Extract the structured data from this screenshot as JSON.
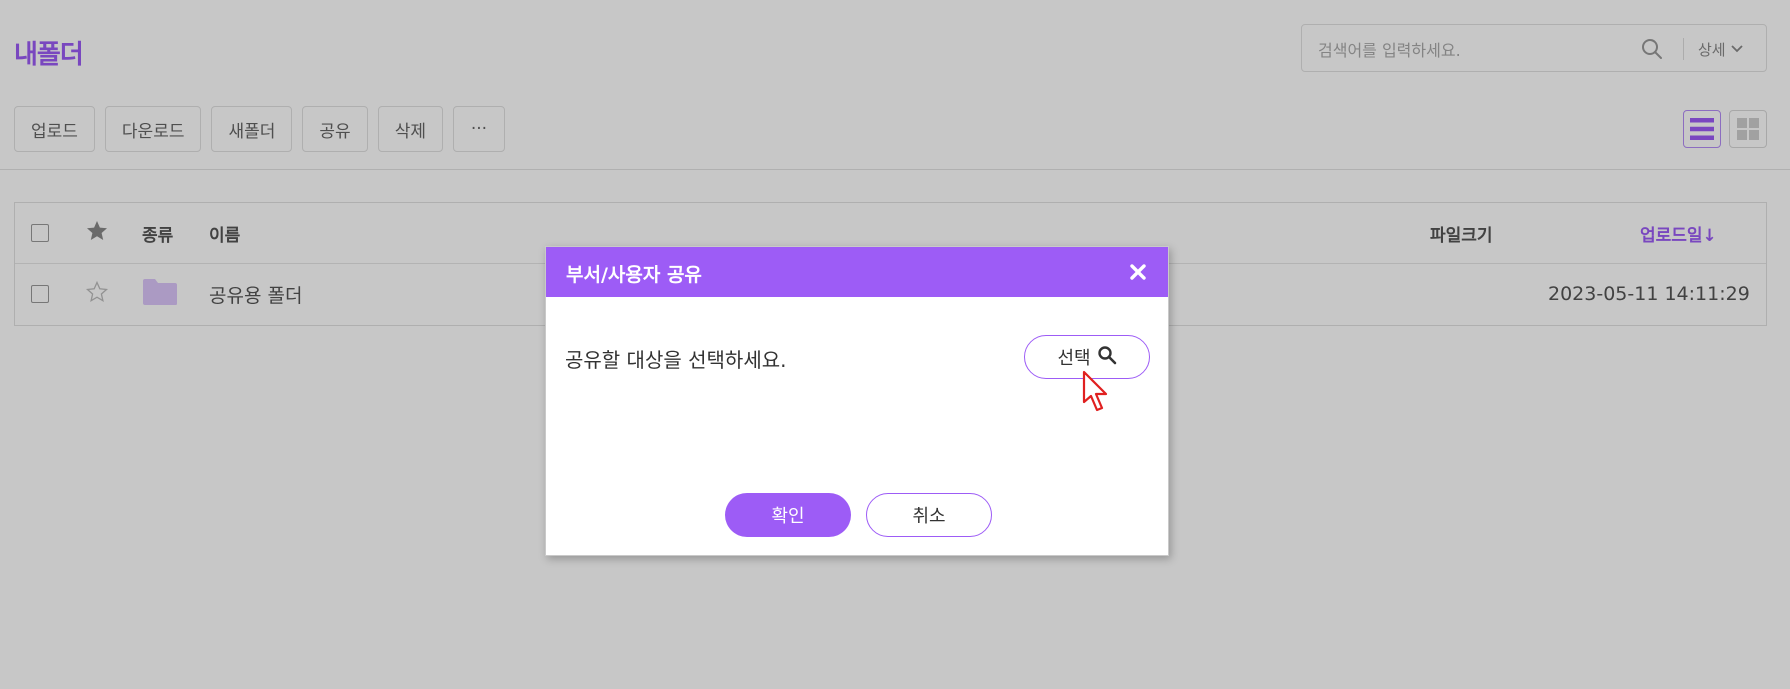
{
  "header": {
    "title": "내폴더",
    "search": {
      "placeholder": "검색어를 입력하세요.",
      "value": "",
      "detail_label": "상세",
      "search_icon": "search-icon",
      "detail_icon": "chevron-down-icon"
    }
  },
  "toolbar": {
    "buttons": [
      {
        "label": "업로드"
      },
      {
        "label": "다운로드"
      },
      {
        "label": "새폴더"
      },
      {
        "label": "공유"
      },
      {
        "label": "삭제"
      },
      {
        "label": "···"
      }
    ],
    "view_modes": [
      {
        "icon": "list-view-icon",
        "active": true
      },
      {
        "icon": "grid-view-icon",
        "active": false
      }
    ]
  },
  "table": {
    "columns": {
      "type": "종류",
      "name": "이름",
      "size": "파일크기",
      "uploaded": "업로드일↓"
    },
    "rows": [
      {
        "type_icon": "folder-icon",
        "name": "공유용 폴더",
        "size": "",
        "uploaded": "2023-05-11 14:11:29",
        "starred": false
      }
    ]
  },
  "dialog": {
    "title": "부서/사용자 공유",
    "prompt": "공유할 대상을 선택하세요.",
    "select_label": "선택",
    "confirm_label": "확인",
    "cancel_label": "취소"
  },
  "colors": {
    "accent": "#9d5cf6",
    "overlay": "rgba(0,0,0,0.22)"
  }
}
